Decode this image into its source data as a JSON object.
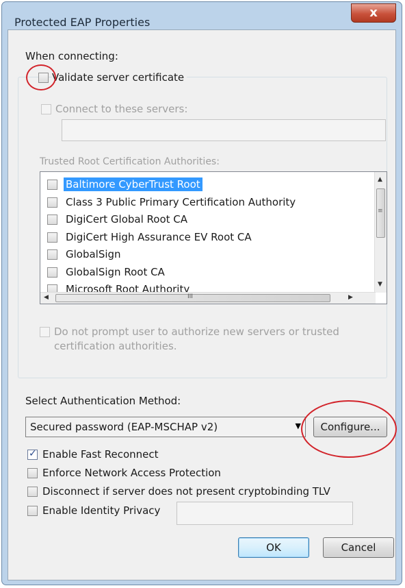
{
  "window": {
    "title": "Protected EAP Properties",
    "close_glyph": "x"
  },
  "connecting": {
    "heading": "When connecting:",
    "validate_cert_label": "Validate server certificate",
    "validate_cert_checked": false,
    "connect_servers_label": "Connect to these servers:",
    "connect_servers_value": "",
    "trusted_root_label": "Trusted Root Certification Authorities:",
    "trusted_roots": [
      {
        "label": "Baltimore CyberTrust Root",
        "checked": false,
        "selected": true
      },
      {
        "label": "Class 3 Public Primary Certification Authority",
        "checked": false,
        "selected": false
      },
      {
        "label": "DigiCert Global Root CA",
        "checked": false,
        "selected": false
      },
      {
        "label": "DigiCert High Assurance EV Root CA",
        "checked": false,
        "selected": false
      },
      {
        "label": "GlobalSign",
        "checked": false,
        "selected": false
      },
      {
        "label": "GlobalSign Root CA",
        "checked": false,
        "selected": false
      },
      {
        "label": "Microsoft Root Authority",
        "checked": false,
        "selected": false
      }
    ],
    "hscroll_grip": "III",
    "vscroll_grip": "≡",
    "no_prompt_line1": "Do not prompt user to authorize new servers or trusted",
    "no_prompt_line2": "certification authorities."
  },
  "auth": {
    "heading": "Select Authentication Method:",
    "method_value": "Secured password (EAP-MSCHAP v2)",
    "configure_label": "Configure...",
    "options": [
      {
        "label": "Enable Fast Reconnect",
        "checked": true
      },
      {
        "label": "Enforce Network Access Protection",
        "checked": false
      },
      {
        "label": "Disconnect if server does not present cryptobinding TLV",
        "checked": false
      },
      {
        "label": "Enable Identity Privacy",
        "checked": false
      }
    ],
    "identity_value": ""
  },
  "footer": {
    "ok_label": "OK",
    "cancel_label": "Cancel"
  },
  "colors": {
    "frame": "#bcd3ea",
    "selection": "#3399ff",
    "annotation": "#d2232a"
  }
}
